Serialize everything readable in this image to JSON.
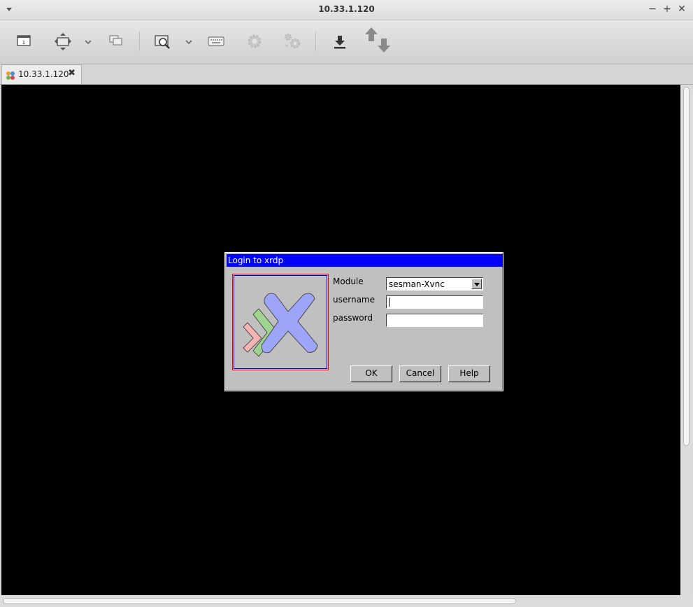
{
  "window": {
    "title": "10.33.1.120",
    "minimize_glyph": "−",
    "maximize_glyph": "+",
    "close_glyph": "✕"
  },
  "toolbar": {
    "icons": [
      "connection-screen-icon",
      "fit-window-icon",
      "dropdown-chevron-icon",
      "multi-monitor-icon",
      "scale-zoom-icon",
      "dropdown-chevron-icon",
      "keyboard-icon",
      "preferences-gear-icon",
      "tools-gears-icon",
      "download-icon",
      "transfer-arrows-icon"
    ]
  },
  "tab": {
    "label": "10.33.1.120",
    "close_glyph": "✖"
  },
  "dialog": {
    "title": "Login to xrdp",
    "module_label": "Module",
    "module_value": "sesman-Xvnc",
    "username_label": "username",
    "username_value": "",
    "password_label": "password",
    "password_value": "",
    "ok_label": "OK",
    "cancel_label": "Cancel",
    "help_label": "Help"
  },
  "colors": {
    "dialog_title_bar": "#0000ff",
    "dialog_bg": "#c0c0c0",
    "remote_bg": "#000000"
  }
}
